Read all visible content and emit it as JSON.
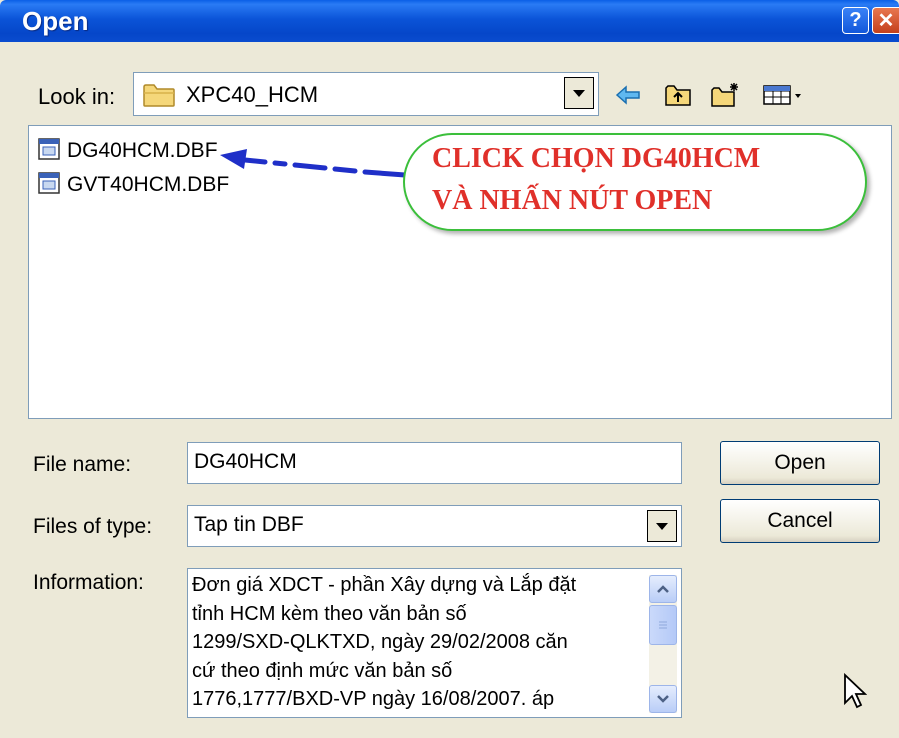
{
  "window": {
    "title": "Open",
    "help_glyph": "?",
    "close_glyph": "✕"
  },
  "lookin": {
    "label": "Look in:",
    "value": "XPC40_HCM",
    "folder_icon": "folder-icon",
    "toolbar_icons": [
      "back-arrow-icon",
      "up-folder-icon",
      "new-folder-icon",
      "view-menu-icon"
    ]
  },
  "files": [
    {
      "name": "DG40HCM.DBF",
      "icon": "dbf-file-icon"
    },
    {
      "name": "GVT40HCM.DBF",
      "icon": "dbf-file-icon"
    }
  ],
  "annotation": {
    "line1": "CLICK CHỌN DG40HCM",
    "line2": "VÀ NHẤN NÚT OPEN",
    "text_color": "#e0302a",
    "border_color": "#3bbf3b",
    "arrow_color": "#1f2fc8"
  },
  "filename": {
    "label": "File name:",
    "value": "DG40HCM"
  },
  "filetype": {
    "label": "Files of type:",
    "value": "Tap tin DBF"
  },
  "information": {
    "label": "Information:",
    "text": "Đơn giá XDCT - phần Xây dựng và Lắp đặt\ntỉnh HCM kèm theo văn bản số\n1299/SXD-QLKTXD, ngày 29/02/2008 căn\ncứ theo định mức văn bản số\n1776,1777/BXD-VP ngày 16/08/2007. áp"
  },
  "buttons": {
    "open": "Open",
    "cancel": "Cancel"
  },
  "colors": {
    "titlebar": "#0b54d8",
    "dialog_bg": "#ece9d8"
  }
}
